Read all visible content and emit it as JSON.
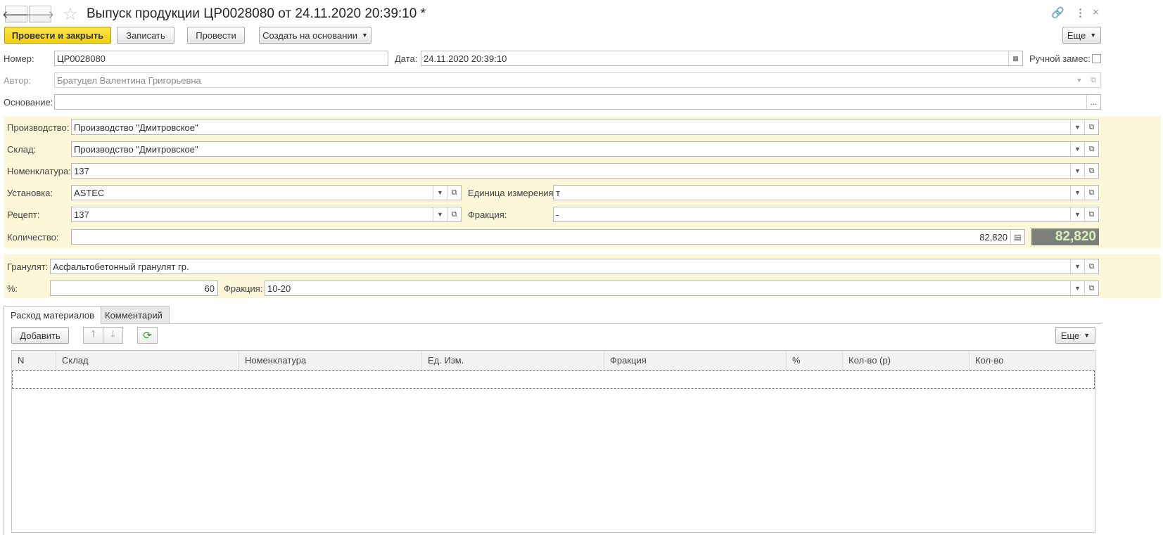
{
  "header": {
    "back_icon": "arrow-left-icon",
    "forward_icon": "arrow-right-icon",
    "title": "Выпуск продукции ЦР0028080 от 24.11.2020 20:39:10 *"
  },
  "toolbar": {
    "post_close": "Провести и закрыть",
    "save": "Записать",
    "post": "Провести",
    "create_based": "Создать на основании",
    "more": "Еще"
  },
  "form": {
    "number_label": "Номер:",
    "number_value": "ЦР0028080",
    "date_label": "Дата:",
    "date_value": "24.11.2020 20:39:10",
    "manual_label": "Ручной замес:",
    "author_label": "Автор:",
    "author_value": "Братуцел Валентина Григорьевна",
    "basis_label": "Основание:",
    "basis_value": "",
    "basis_button": "..."
  },
  "production": {
    "production_label": "Производство:",
    "production_value": "Производство \"Дмитровское\"",
    "warehouse_label": "Склад:",
    "warehouse_value": "Производство \"Дмитровское\"",
    "nomenclature_label": "Номенклатура:",
    "nomenclature_value": "137",
    "installation_label": "Установка:",
    "installation_value": "ASTEC",
    "unit_label": "Единица измерения:",
    "unit_value": "т",
    "recipe_label": "Рецепт:",
    "recipe_value": "137",
    "fraction_label": "Фракция:",
    "fraction_value": "-",
    "quantity_label": "Количество:",
    "quantity_value": "82,820",
    "quantity_display": "82,820"
  },
  "granulate": {
    "label": "Гранулят:",
    "value": "Асфальтобетонный гранулят гр.",
    "percent_label": "%:",
    "percent_value": "60",
    "fraction_label": "Фракция:",
    "fraction_value": "10-20"
  },
  "tabs": [
    {
      "label": "Расход материалов"
    },
    {
      "label": "Комментарий"
    }
  ],
  "table_toolbar": {
    "add": "Добавить",
    "more": "Еще"
  },
  "table": {
    "columns": [
      "N",
      "Склад",
      "Номенклатура",
      "Ед. Изм.",
      "Фракция",
      "%",
      "Кол-во (р)",
      "Кол-во"
    ]
  },
  "colors": {
    "primary_button": "#f2cf10",
    "panel_bg": "#fbf7d9",
    "quantity_display_bg": "#7d8079"
  }
}
